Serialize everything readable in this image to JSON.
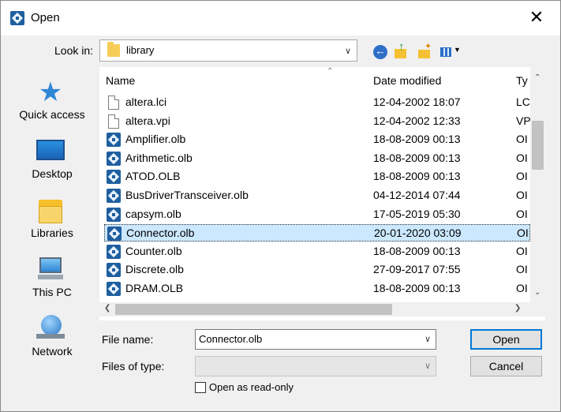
{
  "window": {
    "title": "Open",
    "close_glyph": "✕"
  },
  "lookin": {
    "label": "Look in:",
    "value": "library"
  },
  "toolbar": {
    "icons": [
      "back-icon",
      "up-folder-icon",
      "new-folder-icon",
      "view-menu-icon"
    ]
  },
  "places": [
    {
      "label": "Quick access",
      "icon": "quick-access-star-icon"
    },
    {
      "label": "Desktop",
      "icon": "desktop-icon"
    },
    {
      "label": "Libraries",
      "icon": "libraries-icon"
    },
    {
      "label": "This PC",
      "icon": "this-pc-icon"
    },
    {
      "label": "Network",
      "icon": "network-icon"
    }
  ],
  "columns": {
    "name": "Name",
    "date": "Date modified",
    "type": "Ty"
  },
  "files": [
    {
      "name": "altera.lci",
      "date": "12-04-2002 18:07",
      "type": "LC",
      "icon": "doc"
    },
    {
      "name": "altera.vpi",
      "date": "12-04-2002 12:33",
      "type": "VP",
      "icon": "doc"
    },
    {
      "name": "Amplifier.olb",
      "date": "18-08-2009 00:13",
      "type": "OI",
      "icon": "olb"
    },
    {
      "name": "Arithmetic.olb",
      "date": "18-08-2009 00:13",
      "type": "OI",
      "icon": "olb"
    },
    {
      "name": "ATOD.OLB",
      "date": "18-08-2009 00:13",
      "type": "OI",
      "icon": "olb"
    },
    {
      "name": "BusDriverTransceiver.olb",
      "date": "04-12-2014 07:44",
      "type": "OI",
      "icon": "olb"
    },
    {
      "name": "capsym.olb",
      "date": "17-05-2019 05:30",
      "type": "OI",
      "icon": "olb"
    },
    {
      "name": "Connector.olb",
      "date": "20-01-2020 03:09",
      "type": "OI",
      "icon": "olb",
      "selected": true
    },
    {
      "name": "Counter.olb",
      "date": "18-08-2009 00:13",
      "type": "OI",
      "icon": "olb"
    },
    {
      "name": "Discrete.olb",
      "date": "27-09-2017 07:55",
      "type": "OI",
      "icon": "olb"
    },
    {
      "name": "DRAM.OLB",
      "date": "18-08-2009 00:13",
      "type": "OI",
      "icon": "olb"
    }
  ],
  "filename": {
    "label": "File name:",
    "value": "Connector.olb"
  },
  "filetype": {
    "label": "Files of type:",
    "value": ""
  },
  "readonly": {
    "label": "Open as read-only",
    "checked": false
  },
  "buttons": {
    "open": "Open",
    "cancel": "Cancel"
  }
}
